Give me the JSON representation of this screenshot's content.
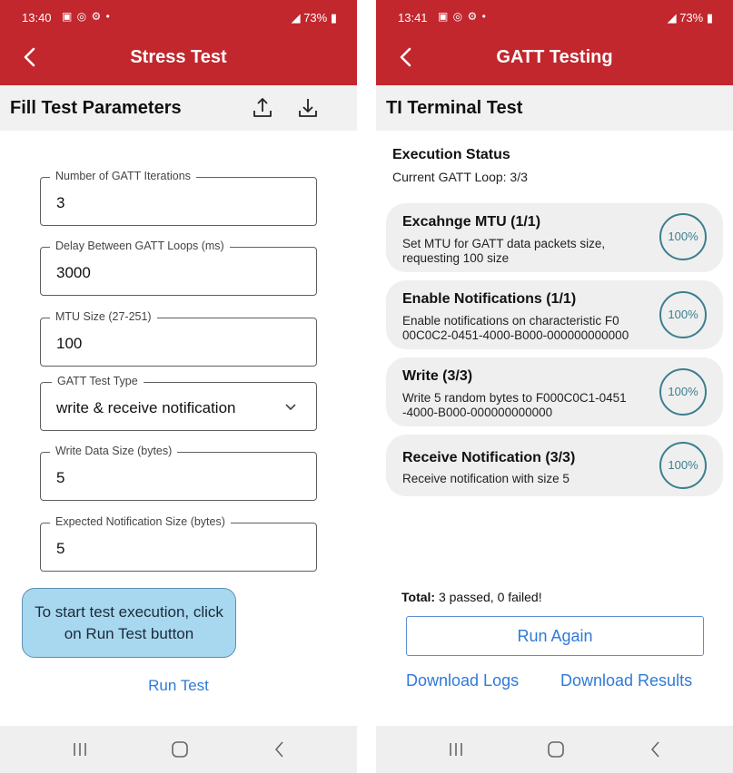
{
  "left": {
    "status": {
      "time": "13:40",
      "icons": "▣ ◎ ⚙ •",
      "battery": "73%"
    },
    "appbar": {
      "title": "Stress Test"
    },
    "section": {
      "title": "Fill Test Parameters"
    },
    "fields": [
      {
        "label": "Number of GATT Iterations",
        "value": "3"
      },
      {
        "label": "Delay Between GATT Loops (ms)",
        "value": "3000"
      },
      {
        "label": "MTU Size (27-251)",
        "value": "100"
      },
      {
        "label": "GATT Test Type",
        "value": "write & receive notification"
      },
      {
        "label": "Write Data Size (bytes)",
        "value": "5"
      },
      {
        "label": "Expected Notification Size (bytes)",
        "value": "5"
      }
    ],
    "tooltip": {
      "line1": "To start test execution, click",
      "line2": "on Run Test button"
    },
    "run_test_label": "Run Test"
  },
  "right": {
    "status": {
      "time": "13:41",
      "icons": "▣ ◎ ⚙ •",
      "battery": "73%"
    },
    "appbar": {
      "title": "GATT Testing"
    },
    "section": {
      "title": "TI Terminal Test"
    },
    "execution": {
      "title": "Execution Status",
      "loop": "Current GATT Loop: 3/3"
    },
    "cards": [
      {
        "title": "Excahnge MTU (1/1)",
        "line1": "Set MTU for GATT data packets size,",
        "line2": "requesting 100 size",
        "progress": "100%"
      },
      {
        "title": "Enable Notifications (1/1)",
        "line1": "Enable notifications on characteristic F0",
        "line2": "00C0C2-0451-4000-B000-000000000000",
        "progress": "100%"
      },
      {
        "title": "Write (3/3)",
        "line1": "Write 5 random bytes to F000C0C1-0451",
        "line2": "-4000-B000-000000000000",
        "progress": "100%"
      },
      {
        "title": "Receive Notification (3/3)",
        "line1": "Receive notification with size 5",
        "line2": "",
        "progress": "100%"
      }
    ],
    "total": {
      "label": "Total:",
      "value": "3 passed, 0 failed!"
    },
    "run_again_label": "Run Again",
    "download_logs_label": "Download Logs",
    "download_results_label": "Download Results"
  },
  "colors": {
    "brand_red": "#c1272d",
    "link_blue": "#2f7ad8",
    "ring_teal": "#3b7f8f",
    "tooltip_bg": "#a8d8f0"
  }
}
